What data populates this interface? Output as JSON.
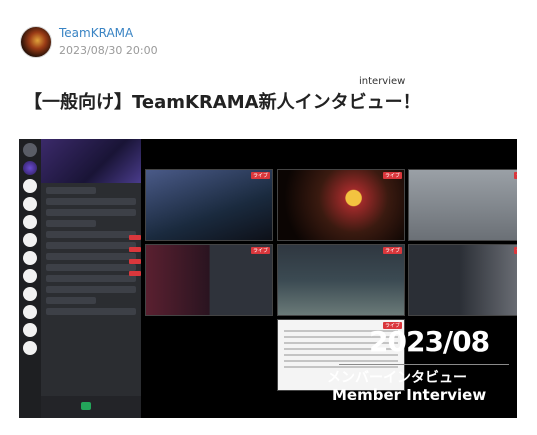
{
  "post": {
    "author": "TeamKRAMA",
    "date": "2023/08/30 20:00",
    "title": "【一般向け】TeamKRAMA新人インタビュー！",
    "ruby": "interview"
  },
  "thumbnail": {
    "year_label": "2023/08",
    "jp_caption": "メンバーインタビュー",
    "en_caption": "Member Interview",
    "live_badge": "ライブ"
  }
}
